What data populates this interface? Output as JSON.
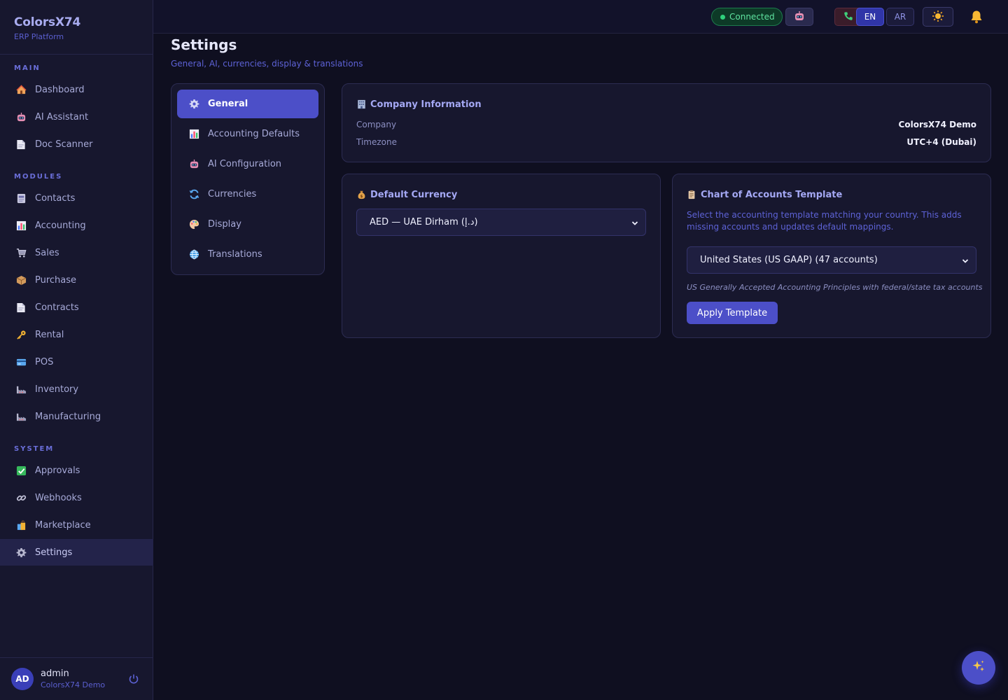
{
  "brand": {
    "title": "ColorsX74",
    "subtitle": "ERP Platform"
  },
  "sidebar": {
    "sections": [
      {
        "label": "MAIN"
      },
      {
        "label": "MODULES"
      },
      {
        "label": "SYSTEM"
      }
    ],
    "items": [
      {
        "label": "Dashboard",
        "icon": "house-icon"
      },
      {
        "label": "AI Assistant",
        "icon": "robot-icon"
      },
      {
        "label": "Doc Scanner",
        "icon": "document-icon"
      },
      {
        "label": "Contacts",
        "icon": "contacts-icon"
      },
      {
        "label": "Accounting",
        "icon": "bar-chart-icon"
      },
      {
        "label": "Sales",
        "icon": "cart-icon"
      },
      {
        "label": "Purchase",
        "icon": "package-icon"
      },
      {
        "label": "Contracts",
        "icon": "document-icon"
      },
      {
        "label": "Rental",
        "icon": "key-icon"
      },
      {
        "label": "POS",
        "icon": "card-icon"
      },
      {
        "label": "Inventory",
        "icon": "factory-icon"
      },
      {
        "label": "Manufacturing",
        "icon": "factory-icon"
      },
      {
        "label": "Approvals",
        "icon": "check-icon"
      },
      {
        "label": "Webhooks",
        "icon": "link-icon"
      },
      {
        "label": "Marketplace",
        "icon": "shopping-bag-icon"
      },
      {
        "label": "Settings",
        "icon": "gear-icon"
      }
    ],
    "active": "Settings"
  },
  "user": {
    "initials": "AD",
    "name": "admin",
    "company": "ColorsX74 Demo"
  },
  "topbar": {
    "status": "Connected",
    "lang_en": "EN",
    "lang_ar": "AR"
  },
  "page": {
    "title": "Settings",
    "subtitle": "General, AI, currencies, display & translations"
  },
  "tabs": [
    {
      "label": "General",
      "icon": "gear-icon"
    },
    {
      "label": "Accounting Defaults",
      "icon": "bar-chart-icon"
    },
    {
      "label": "AI Configuration",
      "icon": "robot-icon"
    },
    {
      "label": "Currencies",
      "icon": "cycle-icon"
    },
    {
      "label": "Display",
      "icon": "palette-icon"
    },
    {
      "label": "Translations",
      "icon": "globe-icon"
    }
  ],
  "company_info": {
    "title": "Company Information",
    "company_label": "Company",
    "company_value": "ColorsX74 Demo",
    "timezone_label": "Timezone",
    "timezone_value": "UTC+4 (Dubai)"
  },
  "currency": {
    "title": "Default Currency",
    "selected": "AED — UAE Dirham (د.إ)"
  },
  "coa": {
    "title": "Chart of Accounts Template",
    "description": "Select the accounting template matching your country. This adds missing accounts and updates default mappings.",
    "selected": "United States (US GAAP) (47 accounts)",
    "hint": "US Generally Accepted Accounting Principles with federal/state tax accounts",
    "apply_label": "Apply Template"
  },
  "colors": {
    "accent": "#4c4fc8",
    "bg": "#0f0f20",
    "panel": "#17172e",
    "success": "#2fd07c"
  }
}
